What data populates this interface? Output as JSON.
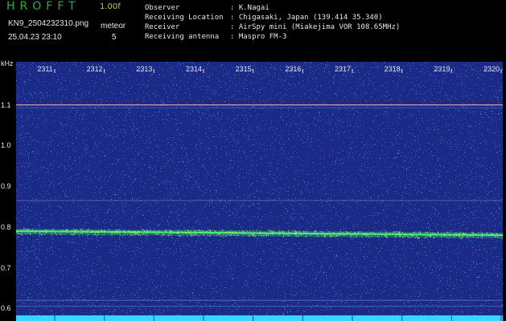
{
  "header": {
    "app_name": "HROFFT",
    "version": "1.00f",
    "file_name": "KN9_2504232310.png",
    "datetime": "25.04.23 23:10",
    "meteor_label": "meteor",
    "meteor_count": "5",
    "info": [
      {
        "label": "Observer",
        "value": ": K.Nagai"
      },
      {
        "label": "Receiving Location",
        "value": ": Chigasaki, Japan (139.414 35.340)"
      },
      {
        "label": "Receiver",
        "value": ": AirSpy mini (Miakejima VOR 108.65MHz)"
      },
      {
        "label": "Receiving antenna",
        "value": ": Maspro FM-3"
      }
    ]
  },
  "chart_data": {
    "type": "heatmap",
    "ylabel": "kHz",
    "y_ticks": [
      "1.1",
      "1.0",
      "0.9",
      "0.8",
      "0.7",
      "0.6"
    ],
    "y_tick_values": [
      1.1,
      1.0,
      0.9,
      0.8,
      0.7,
      0.6
    ],
    "ylim": [
      0.575,
      1.2
    ],
    "time_ticks": [
      "2311",
      "2312",
      "2313",
      "2314",
      "2315",
      "2316",
      "2317",
      "2318",
      "2319",
      "2320"
    ],
    "carrier_khz": [
      0.79,
      0.78
    ],
    "reference_lines_khz": [
      1.1,
      0.865,
      0.62,
      0.605
    ],
    "colors": {
      "background": "#1a2a86",
      "noise": "#2f6cc7",
      "signal": "#43ef7a",
      "upper_line": "#d9a0a6",
      "bottom_band": "#35d6ff",
      "label": "#e6e6e6"
    }
  }
}
